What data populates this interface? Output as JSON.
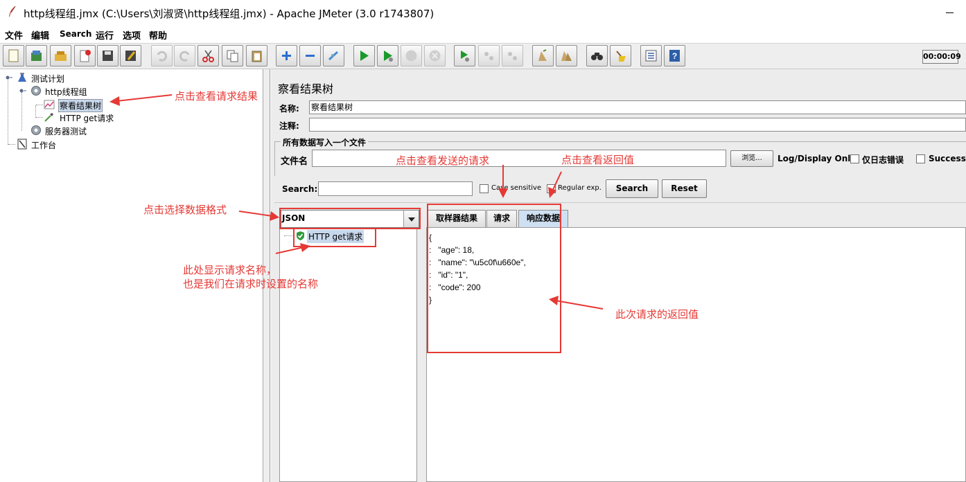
{
  "window": {
    "title": "http线程组.jmx (C:\\Users\\刘淑贤\\http线程组.jmx) - Apache JMeter (3.0 r1743807)"
  },
  "menu": [
    "文件",
    "编辑",
    "Search",
    "运行",
    "选项",
    "帮助"
  ],
  "toolbar": {
    "buttons": [
      "new-icon",
      "templates-icon",
      "open-icon",
      "close-icon",
      "save-icon",
      "save-as-icon",
      "undo-icon",
      "redo-icon",
      "cut-icon",
      "copy-icon",
      "paste-icon",
      "expand-icon",
      "collapse-icon",
      "toggle-icon",
      "start-icon",
      "start-no-pause-icon",
      "stop-icon",
      "shutdown-icon",
      "remote-start-icon",
      "remote-stop-icon",
      "remote-exit-icon",
      "clear-icon",
      "clear-all-icon",
      "search-icon",
      "reset-search-icon",
      "function-helper-icon",
      "help-icon"
    ],
    "timer": "00:00:09"
  },
  "tree": {
    "test_plan": "测试计划",
    "thread_group": "http线程组",
    "listener": "察看结果树",
    "sampler": "HTTP  get请求",
    "server_test": "服务器测试",
    "workbench": "工作台"
  },
  "panel": {
    "title": "察看结果树",
    "name_label": "名称:",
    "name_value": "察看结果树",
    "comment_label": "注释:",
    "file_group_title": "所有数据写入一个文件",
    "filename_label": "文件名",
    "browse_label": "浏览...",
    "log_display_label": "Log/Display Only:",
    "errors_only_label": "仅日志错误",
    "success_label": "Successe",
    "search_label": "Search:",
    "case_sensitive_label": "Case sensitive",
    "regex_label": "Regular exp.",
    "search_button": "Search",
    "reset_button": "Reset",
    "format": "JSON",
    "result_node": "HTTP  get请求",
    "tabs": [
      "取样器结果",
      "请求",
      "响应数据"
    ],
    "response_lines": [
      "{",
      ":   \"age\": 18,",
      ":   \"name\": \"\\u5c0f\\u660e\",",
      ":   \"id\": \"1\",",
      ":   \"code\": 200",
      "}"
    ]
  },
  "annotations": {
    "view_result": "点击查看请求结果",
    "view_request": "点击查看发送的请求",
    "view_response": "点击查看返回值",
    "select_format": "点击选择数据格式",
    "request_name_1": "此处显示请求名称，",
    "request_name_2": "也是我们在请求时设置的名称",
    "return_value": "此次请求的返回值"
  },
  "colors": {
    "annotation": "#e53935",
    "selection": "#c8d8ec",
    "active_tab": "#cfe0f3"
  }
}
